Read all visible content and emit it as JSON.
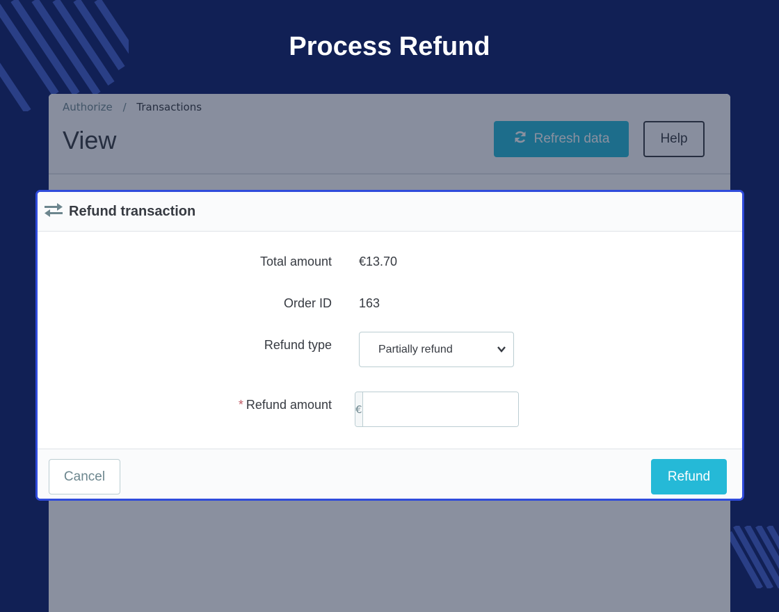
{
  "page_heading": "Process Refund",
  "background": {
    "breadcrumb": [
      "Authorize",
      "Transactions"
    ],
    "breadcrumb_separator": "/",
    "view_title": "View",
    "refresh_button_label": "Refresh data",
    "help_button_label": "Help"
  },
  "modal": {
    "title": "Refund transaction",
    "fields": {
      "total_amount_label": "Total amount",
      "total_amount_value": "€13.70",
      "order_id_label": "Order ID",
      "order_id_value": "163",
      "refund_type_label": "Refund type",
      "refund_type_selected": "Partially refund",
      "refund_amount_required_mark": "*",
      "refund_amount_label": "Refund amount",
      "refund_amount_prefix": "€",
      "refund_amount_value": ""
    },
    "cancel_label": "Cancel",
    "refund_label": "Refund"
  },
  "colors": {
    "background": "#112055",
    "accent": "#25b9d7",
    "modal_border": "#2f4bdb"
  },
  "icons": {
    "refresh": "refresh-icon",
    "exchange": "exchange-icon",
    "chevron": "chevron-down-icon"
  }
}
